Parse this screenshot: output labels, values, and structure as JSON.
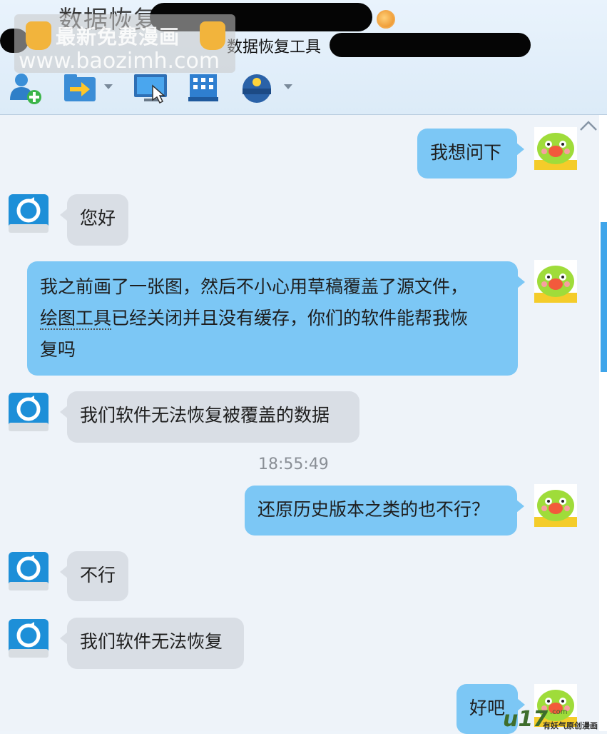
{
  "window": {
    "title": "数据恢复",
    "subtitle": "数据恢复工具"
  },
  "watermark": {
    "line1": "最新免费漫画",
    "line2": "www.baozimh.com"
  },
  "toolbar": {
    "icons": [
      "add-contact-icon",
      "transfer-file-icon",
      "remote-desktop-icon",
      "building-icon",
      "service-cap-icon"
    ]
  },
  "chat": {
    "timestamp": "18:55:49",
    "messages": [
      {
        "side": "out",
        "text": "我想问下"
      },
      {
        "side": "in",
        "text": "您好"
      },
      {
        "side": "out",
        "lines": [
          "我之前画了一张图，然后不小心用草稿覆盖了源文件，",
          "绘图工具",
          "已经关闭并且没有缓存，你们的软件能帮我恢",
          "复吗"
        ]
      },
      {
        "side": "in",
        "text": "我们软件无法恢复被覆盖的数据"
      },
      {
        "side": "out",
        "text": "还原历史版本之类的也不行？"
      },
      {
        "side": "in",
        "text": "不行"
      },
      {
        "side": "in",
        "text": "我们软件无法恢复"
      },
      {
        "side": "out",
        "text": "好吧"
      }
    ]
  },
  "footer": {
    "logo_main": "u17",
    "logo_com": ".com",
    "logo_tagline": "有妖气原创漫画"
  },
  "colors": {
    "outgoing_bubble": "#7cc7f5",
    "incoming_bubble": "#d9dee5",
    "background": "#eef3f9"
  }
}
